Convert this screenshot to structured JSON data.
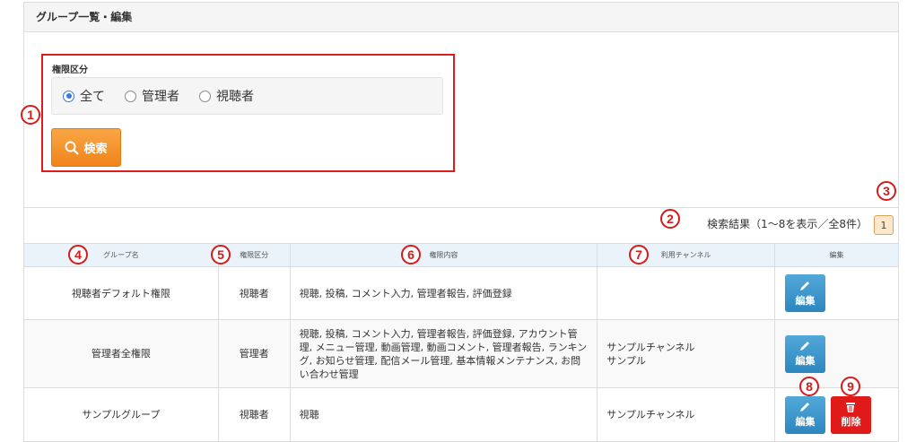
{
  "panel": {
    "title": "グループ一覧・編集"
  },
  "search": {
    "label": "権限区分",
    "options": [
      {
        "label": "全て",
        "checked": true
      },
      {
        "label": "管理者",
        "checked": false
      },
      {
        "label": "視聴者",
        "checked": false
      }
    ],
    "button_label": "検索"
  },
  "results": {
    "summary": "検索結果（1〜8を表示／全8件）",
    "page": "1"
  },
  "table": {
    "headers": [
      "グループ名",
      "権限区分",
      "権限内容",
      "利用チャンネル",
      "編集"
    ],
    "rows": [
      {
        "name": "視聴者デフォルト権限",
        "kind": "視聴者",
        "perms": "視聴, 投稿, コメント入力, 管理者報告, 評価登録",
        "channels": "",
        "edit_label": "編集"
      },
      {
        "name": "管理者全権限",
        "kind": "管理者",
        "perms": "視聴, 投稿, コメント入力, 管理者報告, 評価登録, アカウント管理, メニュー管理, 動画管理, 動画コメント, 管理者報告, ランキング, お知らせ管理, 配信メール管理, 基本情報メンテナンス, お問い合わせ管理",
        "channels": "サンプルチャンネル\nサンプル",
        "edit_label": "編集"
      },
      {
        "name": "サンプルグループ",
        "kind": "視聴者",
        "perms": "視聴",
        "channels": "サンプルチャンネル",
        "edit_label": "編集",
        "delete_label": "削除"
      }
    ]
  },
  "annotations": [
    "1",
    "2",
    "3",
    "4",
    "5",
    "6",
    "7",
    "8",
    "9"
  ],
  "colors": {
    "annotation": "#d71a1a",
    "search_button": "#f0841a",
    "edit_button": "#2c86bf",
    "delete_button": "#e01919"
  }
}
